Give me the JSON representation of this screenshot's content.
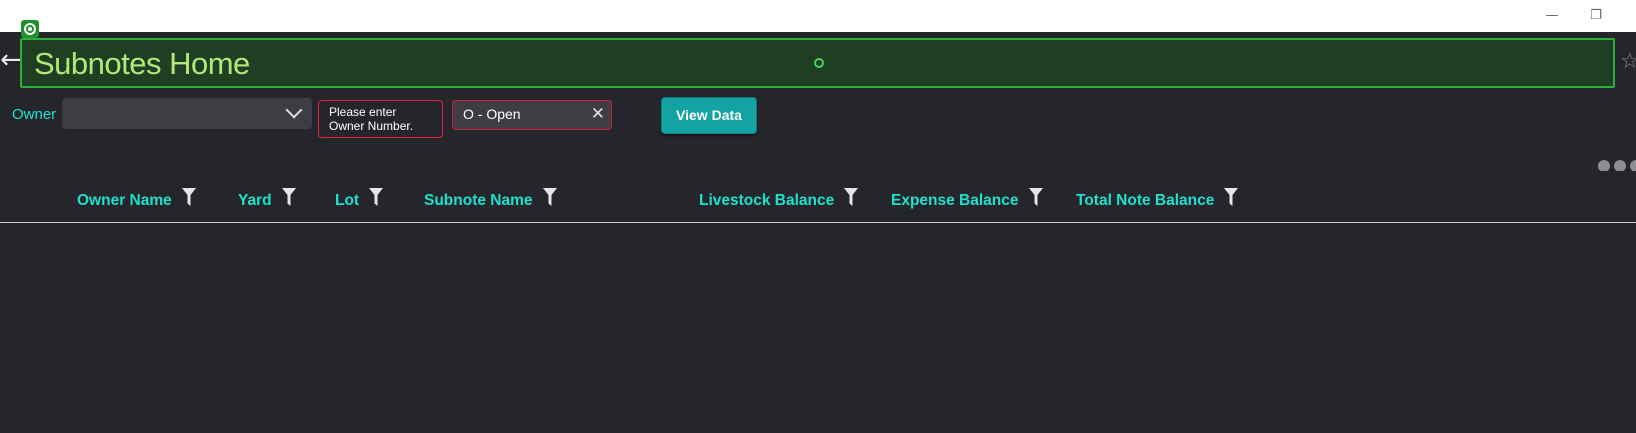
{
  "window": {
    "minimize_glyph": "—",
    "restore_glyph": "❐"
  },
  "header": {
    "title": "Subnotes Home",
    "back_icon": "arrow-left-icon",
    "favorite_icon": "star-icon"
  },
  "filters": {
    "owner_label": "Owner",
    "owner_value": "",
    "owner_error": "Please enter Owner Number.",
    "status_value": "O - Open",
    "view_button_label": "View Data"
  },
  "grid": {
    "columns": [
      "Owner Name",
      "Yard",
      "Lot",
      "Subnote Name",
      "Livestock Balance",
      "Expense Balance",
      "Total Note Balance"
    ],
    "rows": []
  },
  "colors": {
    "accent": "#1ee0cc",
    "title_bar_bg": "#1f3f22",
    "title_border": "#2eae3a",
    "title_text": "#b5e67a",
    "error": "#e0243a",
    "button": "#13a3a3",
    "background": "#25262b"
  }
}
